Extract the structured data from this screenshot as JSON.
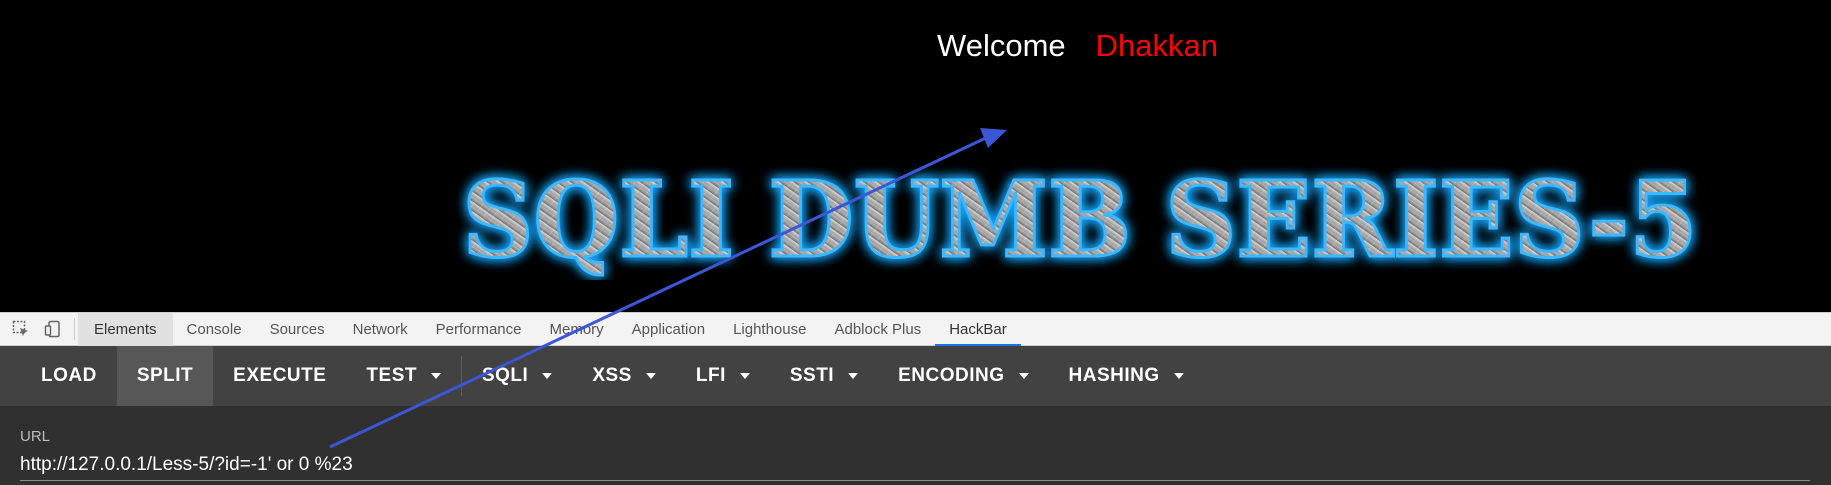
{
  "webpage": {
    "welcome": "Welcome",
    "user": "Dhakkan",
    "banner_text": "SQLI DUMB SERIES-5"
  },
  "devtools": {
    "tabs": [
      {
        "label": "Elements"
      },
      {
        "label": "Console"
      },
      {
        "label": "Sources"
      },
      {
        "label": "Network"
      },
      {
        "label": "Performance"
      },
      {
        "label": "Memory"
      },
      {
        "label": "Application"
      },
      {
        "label": "Lighthouse"
      },
      {
        "label": "Adblock Plus"
      },
      {
        "label": "HackBar"
      }
    ],
    "active_tab": "HackBar"
  },
  "hackbar": {
    "buttons": [
      {
        "label": "LOAD",
        "dropdown": false
      },
      {
        "label": "SPLIT",
        "dropdown": false
      },
      {
        "label": "EXECUTE",
        "dropdown": false
      },
      {
        "label": "TEST",
        "dropdown": true
      },
      {
        "label": "SQLI",
        "dropdown": true
      },
      {
        "label": "XSS",
        "dropdown": true
      },
      {
        "label": "LFI",
        "dropdown": true
      },
      {
        "label": "SSTI",
        "dropdown": true
      },
      {
        "label": "ENCODING",
        "dropdown": true
      },
      {
        "label": "HASHING",
        "dropdown": true
      }
    ],
    "url_label": "URL",
    "url_value": "http://127.0.0.1/Less-5/?id=-1' or 0 %23"
  },
  "colors": {
    "page_background": "#000000",
    "welcome_text": "#ffffff",
    "user_text": "#ff0000",
    "banner_glow": "#1aa8ff",
    "hackbar_bg": "#424242",
    "url_area_bg": "#303030",
    "arrow": "#3b57d6"
  },
  "icons": {
    "inspect": "inspect-element-icon",
    "device": "device-toolbar-icon",
    "caret": "caret-down-icon"
  }
}
